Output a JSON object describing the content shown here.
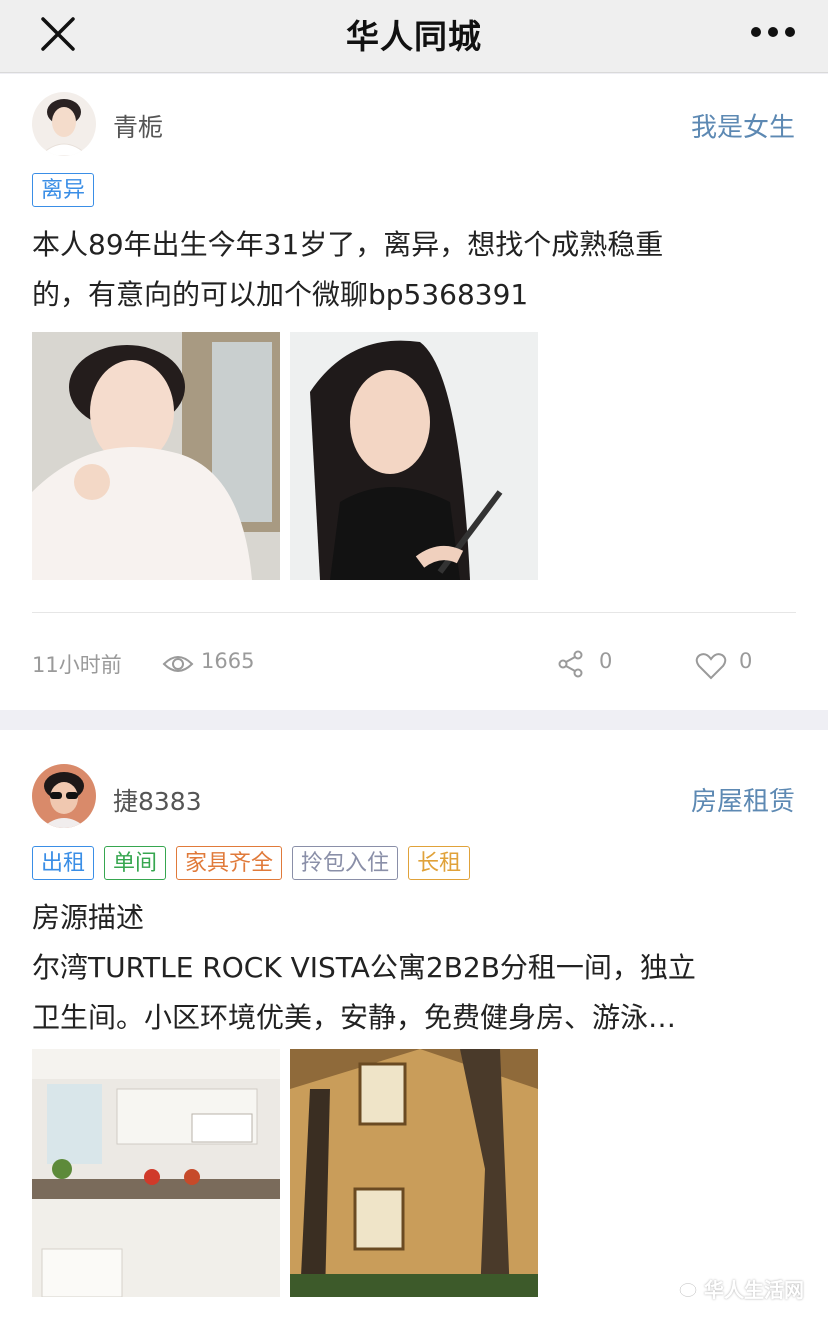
{
  "header": {
    "title": "华人同城"
  },
  "posts": [
    {
      "username": "青栀",
      "category": "我是女生",
      "tags": [
        "离异"
      ],
      "text_line1": "本人89年出生今年31岁了，离异，想找个成熟稳重",
      "text_line2": "的，有意向的可以加个微聊bp5368391",
      "time": "11小时前",
      "views": "1665",
      "shares": "0",
      "likes": "0"
    },
    {
      "username": "捷8383",
      "category": "房屋租赁",
      "tags": [
        "出租",
        "单间",
        "家具齐全",
        "拎包入住",
        "长租"
      ],
      "text_line1": "房源描述",
      "text_line2": "尔湾TURTLE ROCK VISTA公寓2B2B分租一间，独立",
      "text_line3": "卫生间。小区环境优美，安静，免费健身房、游泳…"
    }
  ],
  "watermark": "华人生活网",
  "colors": {
    "link_blue": "#5d89b3",
    "tag_blue": "#3a8ee6",
    "tag_green": "#36a64f",
    "tag_orange": "#e07a3a",
    "tag_gray": "#8a8fa8",
    "tag_gold": "#e0a23a"
  },
  "icons": [
    "close-icon",
    "more-icon",
    "views-icon",
    "share-icon",
    "like-icon",
    "wechat-icon"
  ]
}
